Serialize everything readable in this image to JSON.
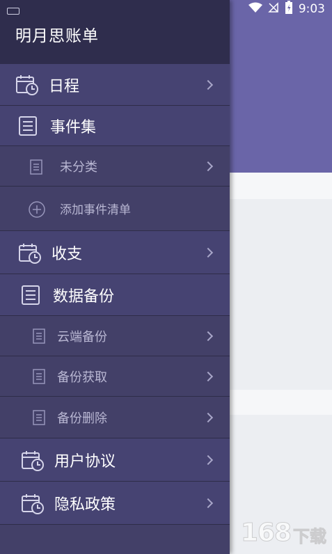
{
  "status_bar": {
    "time": "9:03"
  },
  "drawer": {
    "title": "明月思账单",
    "items": [
      {
        "label": "日程",
        "icon": "calendar-clock-icon"
      },
      {
        "label": "事件集",
        "icon": "notebook-icon"
      },
      {
        "label": "未分类",
        "icon": "document-icon"
      },
      {
        "label": "添加事件清单",
        "icon": "add-circle-icon"
      },
      {
        "label": "收支",
        "icon": "calendar-clock-icon"
      },
      {
        "label": "数据备份",
        "icon": "notebook-icon"
      },
      {
        "label": "云端备份",
        "icon": "document-icon"
      },
      {
        "label": "备份获取",
        "icon": "document-icon"
      },
      {
        "label": "备份删除",
        "icon": "document-icon"
      },
      {
        "label": "用户协议",
        "icon": "calendar-clock-icon"
      },
      {
        "label": "隐私政策",
        "icon": "calendar-clock-icon"
      }
    ]
  },
  "watermark": {
    "number": "168",
    "text": "下载"
  },
  "colors": {
    "header": "#6a65a8",
    "drawer": "#434068",
    "drawer_header": "#2f2d4d"
  }
}
